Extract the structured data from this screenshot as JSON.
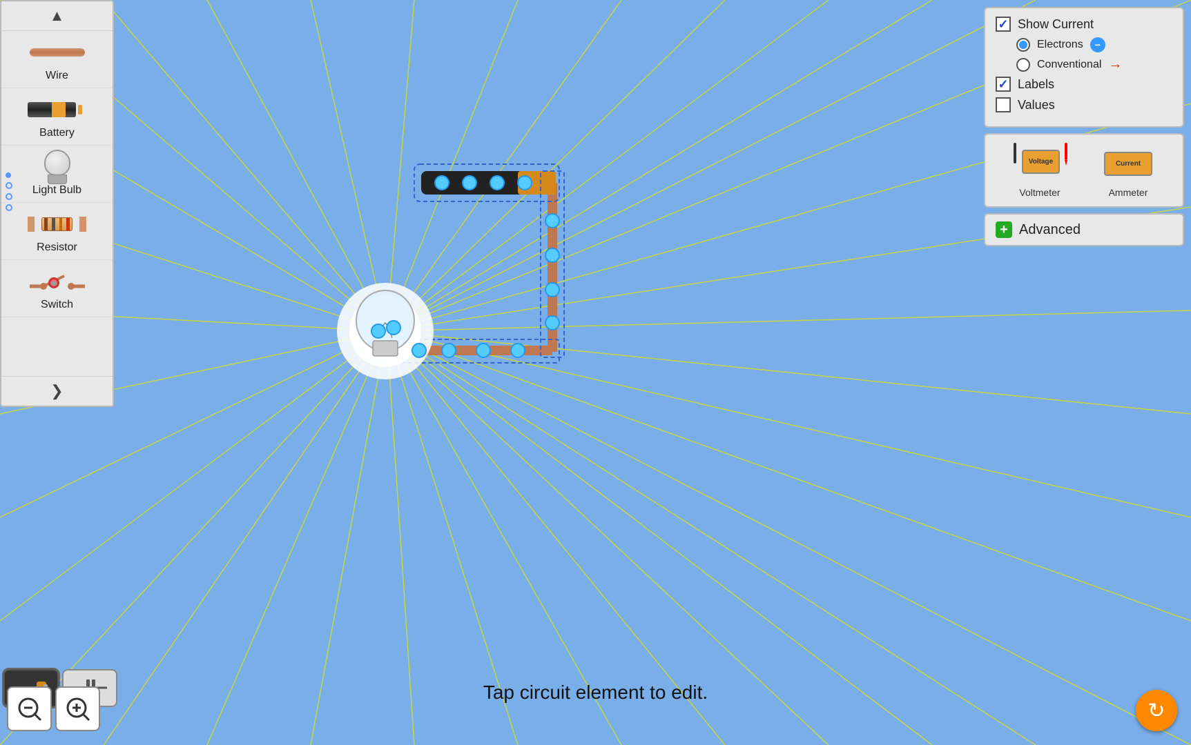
{
  "sidebar": {
    "items": [
      {
        "label": "Wire",
        "icon": "wire"
      },
      {
        "label": "Battery",
        "icon": "battery"
      },
      {
        "label": "Light Bulb",
        "icon": "light-bulb"
      },
      {
        "label": "Resistor",
        "icon": "resistor"
      },
      {
        "label": "Switch",
        "icon": "switch"
      }
    ],
    "up_arrow": "▲",
    "down_arrow": "❯"
  },
  "controls": {
    "show_current_label": "Show Current",
    "electrons_label": "Electrons",
    "conventional_label": "Conventional",
    "labels_label": "Labels",
    "values_label": "Values",
    "show_current_checked": true,
    "electrons_selected": true,
    "conventional_selected": false,
    "labels_checked": true,
    "values_checked": false
  },
  "meters": {
    "voltmeter_label": "Voltmeter",
    "voltmeter_display": "Voltage",
    "ammeter_label": "Ammeter",
    "ammeter_display": "Current"
  },
  "advanced": {
    "label": "Advanced"
  },
  "status": {
    "message": "Tap circuit element to edit."
  },
  "toolbar": {
    "battery_tool": "battery-tool",
    "capacitor_tool": "capacitor-tool"
  },
  "zoom": {
    "minus_label": "−",
    "plus_label": "+"
  }
}
